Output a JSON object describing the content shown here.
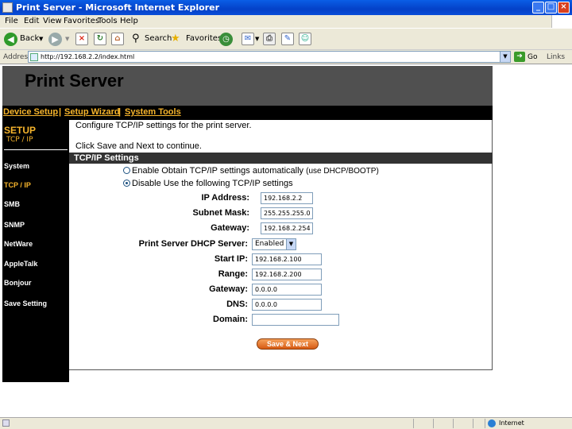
{
  "window": {
    "title": "Print Server - Microsoft Internet Explorer"
  },
  "menu": [
    "File",
    "Edit",
    "View",
    "Favorites",
    "Tools",
    "Help"
  ],
  "toolbar": {
    "back_label": "Back",
    "search_label": "Search",
    "favorites_label": "Favorites"
  },
  "address": {
    "label": "Address",
    "url": "http://192.168.2.2/index.html",
    "go_label": "Go",
    "links_label": "Links"
  },
  "banner": {
    "title": "Print Server"
  },
  "nav": {
    "device_setup": "Device Setup",
    "setup_wizard": "Setup Wizard",
    "system_tools": "System Tools",
    "sep1": "|",
    "sep2": "|"
  },
  "sidebar": {
    "title": "SETUP",
    "subtitle": "TCP / IP",
    "items": [
      {
        "label": "System",
        "active": false
      },
      {
        "label": "TCP / IP",
        "active": true
      },
      {
        "label": "SMB",
        "active": false
      },
      {
        "label": "SNMP",
        "active": false
      },
      {
        "label": "NetWare",
        "active": false
      },
      {
        "label": "AppleTalk",
        "active": false
      },
      {
        "label": "Bonjour",
        "active": false
      },
      {
        "label": "Save Setting",
        "active": false
      }
    ]
  },
  "content": {
    "desc1": "Configure TCP/IP settings for the print server.",
    "desc2": "Click Save and Next to continue.",
    "section_title": "TCP/IP Settings",
    "radio_auto": {
      "label": "Enable Obtain TCP/IP settings automatically",
      "note": "(use DHCP/BOOTP)",
      "selected": false
    },
    "radio_manual": {
      "label": "Disable Use the following TCP/IP settings",
      "selected": true
    },
    "fields": {
      "ip_address": {
        "label": "IP Address:",
        "value": "192.168.2.2"
      },
      "subnet_mask": {
        "label": "Subnet Mask:",
        "value": "255.255.255.0"
      },
      "gateway": {
        "label": "Gateway:",
        "value": "192.168.2.254"
      },
      "dhcp_server": {
        "label": "Print Server DHCP Server:",
        "value": "Enabled"
      },
      "start_ip": {
        "label": "Start IP:",
        "value": "192.168.2.100"
      },
      "range": {
        "label": "Range:",
        "value": "192.168.2.200"
      },
      "dhcp_gateway": {
        "label": "Gateway:",
        "value": "0.0.0.0"
      },
      "dns": {
        "label": "DNS:",
        "value": "0.0.0.0"
      },
      "domain": {
        "label": "Domain:",
        "value": ""
      }
    },
    "save_label": "Save & Next"
  },
  "status": {
    "zone": "Internet"
  }
}
